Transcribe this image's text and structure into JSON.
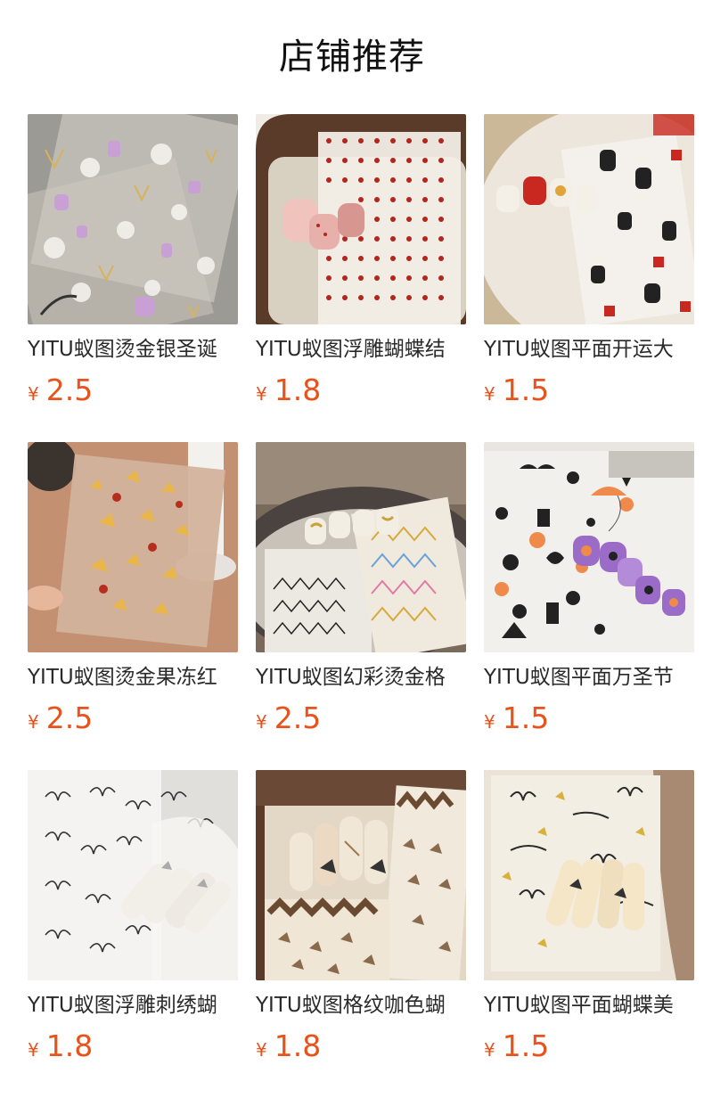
{
  "section": {
    "title": "店铺推荐"
  },
  "colors": {
    "price": "#e8531c",
    "title": "#111111",
    "name": "#2a2a2a"
  },
  "products": [
    {
      "name": "YITU蚁图烫金银圣诞",
      "currency": "¥",
      "price": "2.5",
      "image": "christmas-sticker-photo"
    },
    {
      "name": "YITU蚁图浮雕蝴蝶结",
      "currency": "¥",
      "price": "1.8",
      "image": "red-bow-sticker-photo"
    },
    {
      "name": "YITU蚁图平面开运大",
      "currency": "¥",
      "price": "1.5",
      "image": "lucky-cartoon-sticker-photo"
    },
    {
      "name": "YITU蚁图烫金果冻红",
      "currency": "¥",
      "price": "2.5",
      "image": "gold-butterfly-sticker-photo"
    },
    {
      "name": "YITU蚁图幻彩烫金格",
      "currency": "¥",
      "price": "2.5",
      "image": "iridescent-grid-sticker-photo"
    },
    {
      "name": "YITU蚁图平面万圣节",
      "currency": "¥",
      "price": "1.5",
      "image": "halloween-sticker-photo"
    },
    {
      "name": "YITU蚁图浮雕刺绣蝴",
      "currency": "¥",
      "price": "1.8",
      "image": "embroidered-butterfly-sticker-photo"
    },
    {
      "name": "YITU蚁图格纹咖色蝴",
      "currency": "¥",
      "price": "1.8",
      "image": "brown-plaid-butterfly-sticker-photo"
    },
    {
      "name": "YITU蚁图平面蝴蝶美",
      "currency": "¥",
      "price": "1.5",
      "image": "flat-butterfly-sticker-photo"
    }
  ]
}
